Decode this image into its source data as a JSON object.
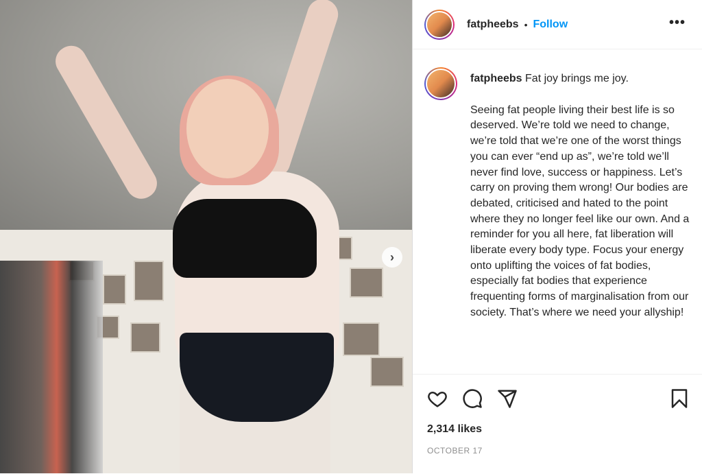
{
  "post": {
    "username": "fatpheebs",
    "separator": "•",
    "follow_label": "Follow",
    "more_label": "•••",
    "next_label": "›"
  },
  "caption": {
    "username": "fatpheebs",
    "first_line": "Fat joy brings me joy.",
    "body": "Seeing fat people living their best life is so deserved. We’re told we need to change, we’re told that we’re one of the worst things you can ever “end up as”, we’re told we’ll never find love, success or happiness. Let’s carry on proving them wrong! Our bodies are debated, criticised and hated to the point where they no longer feel like our own. And a reminder for you all here, fat liberation will liberate every body type. Focus your energy onto uplifting the voices of fat bodies, especially fat bodies that experience frequenting forms of marginalisation from our society. That’s where we need your allyship!"
  },
  "stats": {
    "likes": "2,314 likes",
    "date": "OCTOBER 17"
  },
  "icons": {
    "like": "heart-icon",
    "comment": "comment-icon",
    "share": "share-icon",
    "save": "bookmark-icon"
  },
  "colors": {
    "follow": "#0095f6",
    "text": "#262626",
    "muted": "#8e8e8e"
  }
}
